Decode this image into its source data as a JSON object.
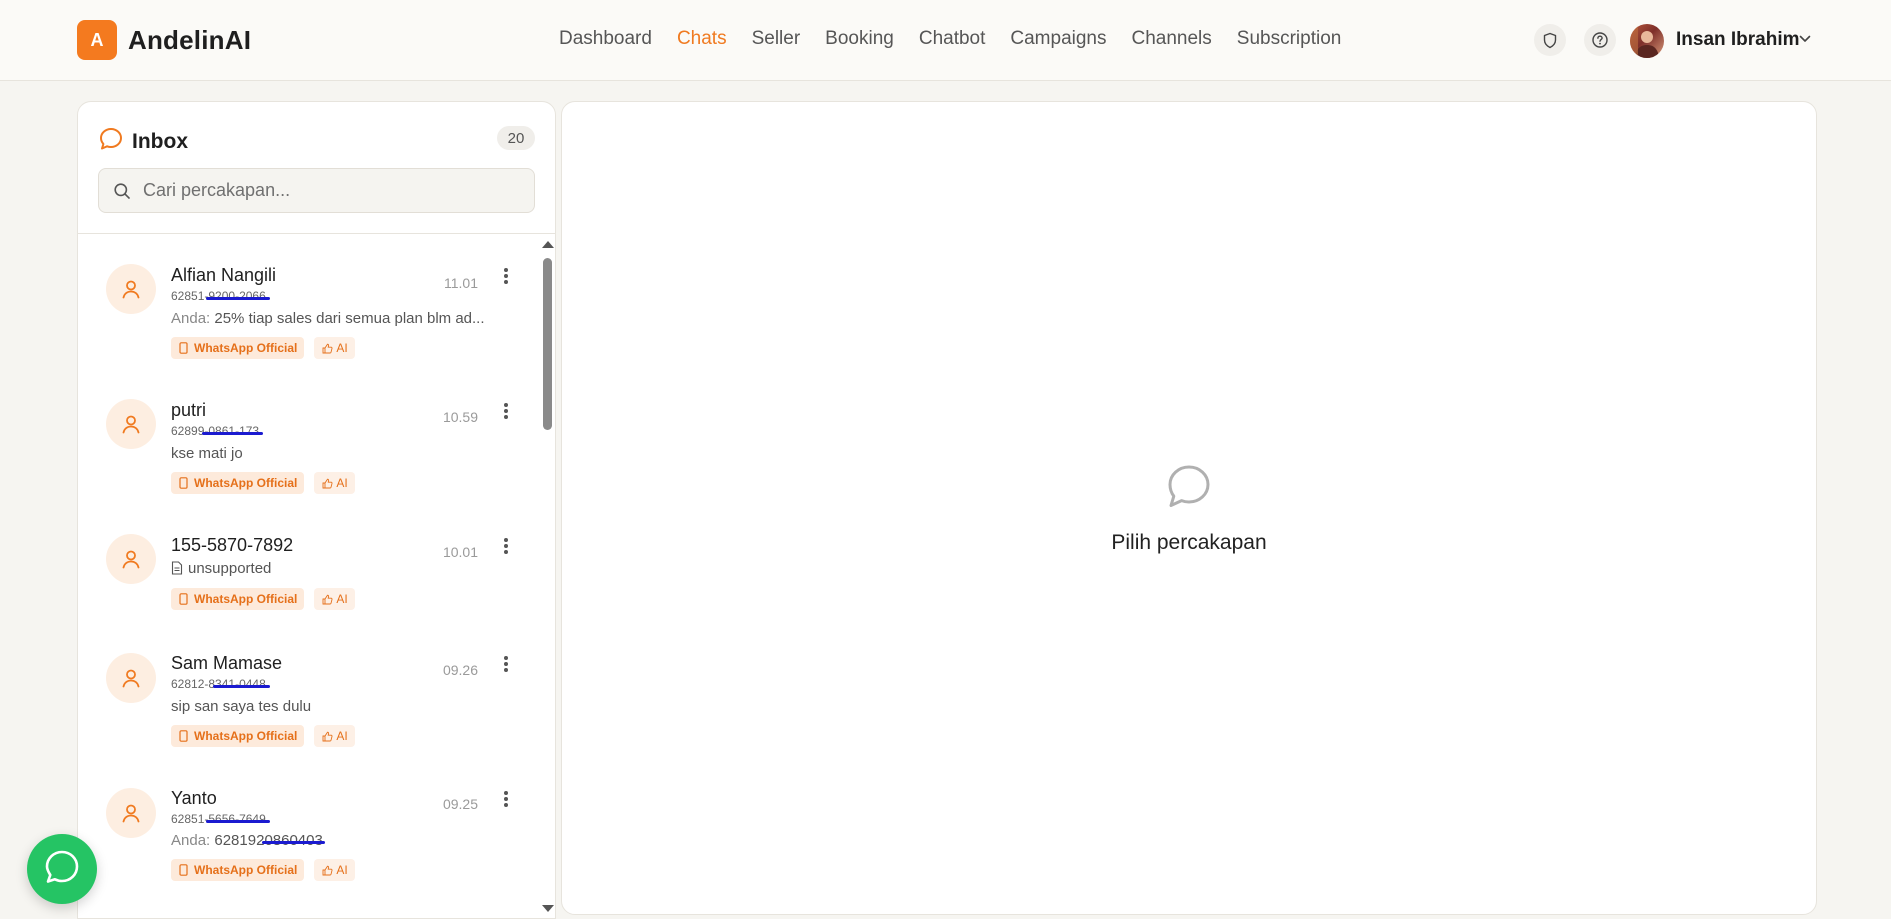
{
  "brand": {
    "logo_letter": "A",
    "name": "AndelinAI",
    "accent": "#f47a1f"
  },
  "nav": [
    {
      "label": "Dashboard",
      "active": false
    },
    {
      "label": "Chats",
      "active": true
    },
    {
      "label": "Seller",
      "active": false
    },
    {
      "label": "Booking",
      "active": false
    },
    {
      "label": "Chatbot",
      "active": false
    },
    {
      "label": "Campaigns",
      "active": false
    },
    {
      "label": "Channels",
      "active": false
    },
    {
      "label": "Subscription",
      "active": false
    }
  ],
  "header": {
    "icons": [
      "shield-icon",
      "help-icon"
    ],
    "user_name": "Insan Ibrahim"
  },
  "inbox": {
    "title": "Inbox",
    "count": "20",
    "search_placeholder": "Cari percakapan...",
    "chats": [
      {
        "name": "Alfian Nangili",
        "phone_visible": "62851-",
        "phone_redacted": "9200-2066",
        "time": "11.01",
        "msg_prefix": "Anda: ",
        "msg": "25% tiap sales dari semua plan blm ad...",
        "badge_channel": "WhatsApp Official",
        "badge_ai": "AI"
      },
      {
        "name": "putri",
        "phone_visible": "62899",
        "phone_redacted": "-0861-173",
        "time": "10.59",
        "msg_prefix": "",
        "msg": "kse mati jo",
        "badge_channel": "WhatsApp Official",
        "badge_ai": "AI"
      },
      {
        "name": "155-5870-7892",
        "phone_visible": "",
        "phone_redacted": "",
        "time": "10.01",
        "msg_prefix": "",
        "msg": "unsupported",
        "badge_channel": "WhatsApp Official",
        "badge_ai": "AI"
      },
      {
        "name": "Sam Mamase",
        "phone_visible": "62812-8",
        "phone_redacted": "341-0448",
        "time": "09.26",
        "msg_prefix": "",
        "msg": "sip san saya tes dulu",
        "badge_channel": "WhatsApp Official",
        "badge_ai": "AI"
      },
      {
        "name": "Yanto",
        "phone_visible": "62851-",
        "phone_redacted": "5656-7649",
        "time": "09.25",
        "msg_prefix": "Anda: ",
        "msg_visible": "628192",
        "msg_redacted": "0860403",
        "badge_channel": "WhatsApp Official",
        "badge_ai": "AI"
      }
    ]
  },
  "conversation": {
    "empty_text": "Pilih percakapan"
  }
}
